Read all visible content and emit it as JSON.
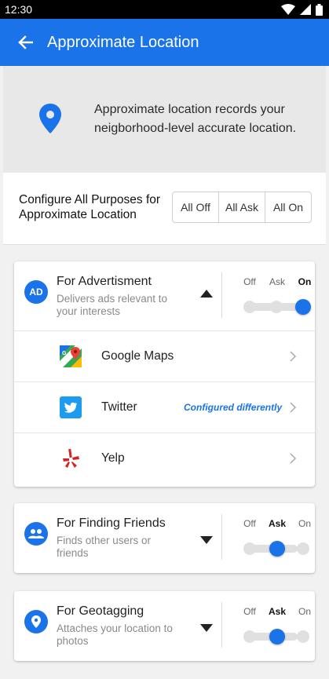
{
  "status_bar": {
    "time": "12:30",
    "icons": [
      "wifi-icon",
      "signal-icon",
      "battery-icon"
    ]
  },
  "app_bar": {
    "back_icon": "arrow-left-icon",
    "title": "Approximate Location",
    "color": "#1a73e8"
  },
  "info": {
    "icon": "location-pin-icon",
    "text": "Approximate location records your neigborhood-level accurate location."
  },
  "configure_all": {
    "label": "Configure All Purposes for Approximate Location",
    "buttons": [
      "All Off",
      "All Ask",
      "All On"
    ]
  },
  "purposes": [
    {
      "badge": "AD",
      "icon": "ad-badge-icon",
      "title": "For Advertisment",
      "description": "Delivers ads relevant to your interests",
      "expanded": true,
      "caret_icon": "caret-up-icon",
      "options": [
        "Off",
        "Ask",
        "On"
      ],
      "selected": "On",
      "apps": [
        {
          "name": "Google Maps",
          "icon": "google-maps-icon",
          "note": ""
        },
        {
          "name": "Twitter",
          "icon": "twitter-icon",
          "note": "Configured differently"
        },
        {
          "name": "Yelp",
          "icon": "yelp-icon",
          "note": ""
        }
      ]
    },
    {
      "icon": "people-icon",
      "title": "For Finding Friends",
      "description": "Finds other users or friends",
      "expanded": false,
      "caret_icon": "caret-down-icon",
      "options": [
        "Off",
        "Ask",
        "On"
      ],
      "selected": "Ask"
    },
    {
      "icon": "location-pin-icon",
      "title": "For Geotagging",
      "description": "Attaches your location to photos",
      "expanded": false,
      "caret_icon": "caret-down-icon",
      "options": [
        "Off",
        "Ask",
        "On"
      ],
      "selected": "Ask"
    }
  ]
}
